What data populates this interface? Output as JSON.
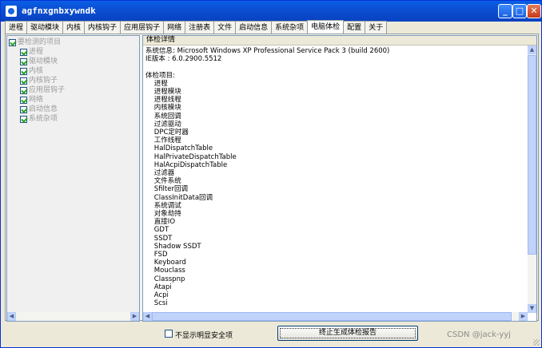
{
  "window": {
    "title": "agfnxgnbxywndk"
  },
  "tabs": [
    "进程",
    "驱动模块",
    "内核",
    "内核钩子",
    "应用层钩子",
    "网络",
    "注册表",
    "文件",
    "启动信息",
    "系统杂项",
    "电脑体检",
    "配置",
    "关于"
  ],
  "active_tab": "电脑体检",
  "tree": {
    "root": "要检测的项目",
    "items": [
      "进程",
      "驱动模块",
      "内核",
      "内核钩子",
      "应用层钩子",
      "网络",
      "启动信息",
      "系统杂项"
    ]
  },
  "panel": {
    "header": "体检详情",
    "lines": [
      "系统信息: Microsoft Windows XP Professional Service Pack 3 (build 2600)",
      "IE版本 : 6.0.2900.5512",
      "",
      "体检项目:",
      "    进程",
      "    进程模块",
      "    进程线程",
      "    内核模块",
      "    系统回调",
      "    过滤驱动",
      "    DPC定时器",
      "    工作线程",
      "    HalDispatchTable",
      "    HalPrivateDispatchTable",
      "    HalAcpiDispatchTable",
      "    过滤器",
      "    文件系统",
      "    Sfilter回调",
      "    ClassInitData回调",
      "    系统调试",
      "    对象劫持",
      "    直接IO",
      "    GDT",
      "    SSDT",
      "    Shadow SSDT",
      "    FSD",
      "    Keyboard",
      "    Mouclass",
      "    Classpnp",
      "    Atapi",
      "    Acpi",
      "    Scsi"
    ]
  },
  "footer": {
    "checkbox_label": "不显示明显安全项",
    "stop_button": "终止生成体检报告",
    "watermark": "CSDN @jack-yyj"
  }
}
